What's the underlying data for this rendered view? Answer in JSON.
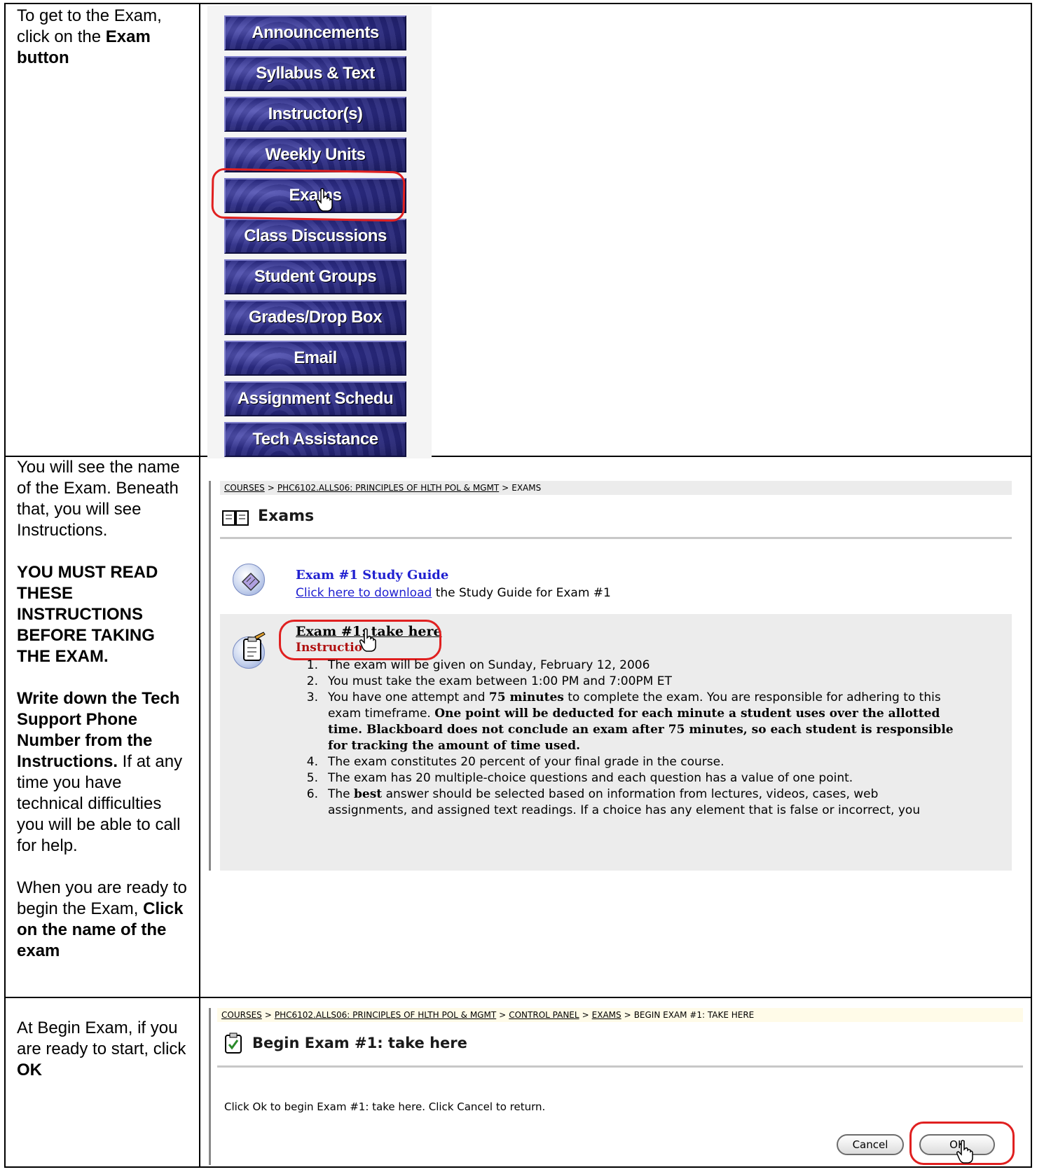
{
  "rows": [
    {
      "instruction": {
        "line1": "To get to the Exam,",
        "line2_pre": "click on the ",
        "line2_bold": "Exam",
        "line3_bold": "button"
      },
      "nav_buttons": [
        "Announcements",
        "Syllabus & Text",
        "Instructor(s)",
        "Weekly Units",
        "Exams",
        "Class Discussions",
        "Student Groups",
        "Grades/Drop Box",
        "Email",
        "Assignment Schedu",
        "Tech Assistance"
      ]
    },
    {
      "instruction": {
        "p1": "You will see the name of the Exam. Beneath that, you will see Instructions.",
        "p2_bold": "YOU MUST READ THESE INSTRUCTIONS BEFORE TAKING THE EXAM.",
        "p3_bold": "Write down the Tech Support Phone Number from the Instructions.",
        "p3_rest": " If at any time you have technical difficulties you will be able to call for help.",
        "p4_pre": "When you are ready to begin the Exam, ",
        "p4_bold": "Click on the name of the exam"
      },
      "screenshot": {
        "breadcrumb": [
          "COURSES",
          "PHC6102.ALLS06: PRINCIPLES OF HLTH POL & MGMT",
          "EXAMS"
        ],
        "heading": "Exams",
        "study_guide": {
          "title": "Exam #1 Study Guide",
          "link": "Click here to download",
          "rest": " the Study Guide for Exam #1"
        },
        "exam": {
          "title": "Exam #1: take here",
          "instructions_label": "Instructio",
          "items": [
            {
              "n": "1.",
              "text": "The exam will be given on Sunday, February 12, 2006"
            },
            {
              "n": "2.",
              "text": "You must take the exam between 1:00 PM and 7:00PM ET"
            },
            {
              "n": "3.",
              "pre": "You have one attempt and ",
              "bold1": "75 minutes",
              "mid": " to complete the exam.  You are responsible for adhering to this",
              "line2_pre": "exam timeframe.  ",
              "bold2": "One point will be deducted for each minute a student uses over the allotted",
              "bold3": "time.  Blackboard does not conclude an exam after 75 minutes, so each student is responsible",
              "bold4": "for tracking the amount of time used."
            },
            {
              "n": "4.",
              "text": "The exam constitutes 20 percent of your final grade in the course."
            },
            {
              "n": "5.",
              "text": "The exam has 20 multiple-choice questions and each question has a value of one point."
            },
            {
              "n": "6.",
              "pre": "The ",
              "bold1": "best",
              "mid": " answer should be selected based on information from lectures, videos, cases, web",
              "line2": "assignments, and assigned text readings.  If a choice has any element that is false or incorrect, you"
            }
          ]
        }
      }
    },
    {
      "instruction": {
        "pre": "At Begin Exam, if you are ready to start, click ",
        "bold": "OK"
      },
      "screenshot": {
        "breadcrumb": [
          "COURSES",
          "PHC6102.ALLS06: PRINCIPLES OF HLTH POL & MGMT",
          "CONTROL PANEL",
          "EXAMS",
          "BEGIN EXAM #1: TAKE HERE"
        ],
        "heading": "Begin Exam #1: take here",
        "message": "Click Ok to begin Exam #1: take here. Click Cancel to return.",
        "cancel_label": "Cancel",
        "ok_label": "OK"
      }
    }
  ]
}
